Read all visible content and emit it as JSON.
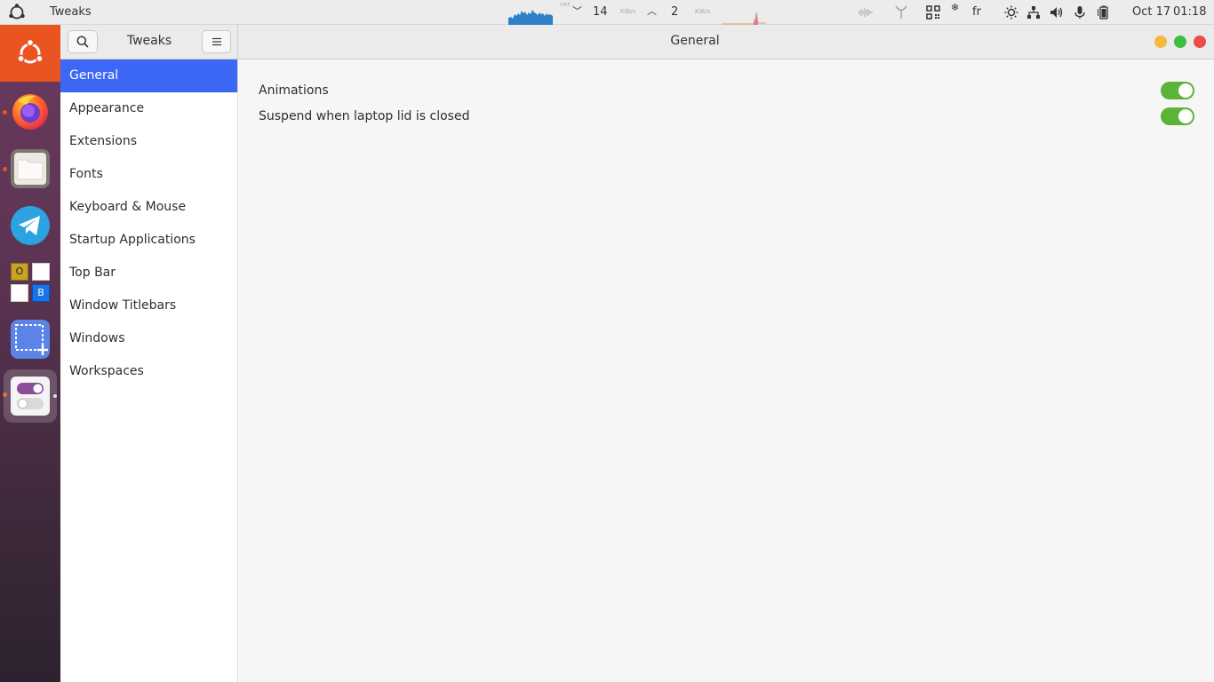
{
  "topbar": {
    "app_name": "Tweaks",
    "net_label": "net",
    "down_value": "14",
    "down_unit": "KiB/s",
    "up_value": "2",
    "up_unit": "KiB/s",
    "keyboard_layout": "fr",
    "date": "Oct 17",
    "time": "01:18"
  },
  "dock": {
    "items": [
      {
        "name": "ubuntu-logo"
      },
      {
        "name": "firefox"
      },
      {
        "name": "files"
      },
      {
        "name": "telegram"
      },
      {
        "name": "office-apps",
        "letters": [
          "O",
          "B"
        ]
      },
      {
        "name": "screenshot"
      },
      {
        "name": "tweaks"
      }
    ]
  },
  "header": {
    "left_title": "Tweaks",
    "title": "General"
  },
  "sidebar": {
    "items": [
      {
        "label": "General",
        "selected": true
      },
      {
        "label": "Appearance"
      },
      {
        "label": "Extensions"
      },
      {
        "label": "Fonts"
      },
      {
        "label": "Keyboard & Mouse"
      },
      {
        "label": "Startup Applications"
      },
      {
        "label": "Top Bar"
      },
      {
        "label": "Window Titlebars"
      },
      {
        "label": "Windows"
      },
      {
        "label": "Workspaces"
      }
    ]
  },
  "main": {
    "settings": [
      {
        "label": "Animations",
        "enabled": true
      },
      {
        "label": "Suspend when laptop lid is closed",
        "enabled": true
      }
    ]
  },
  "colors": {
    "accent": "#3d68f5",
    "switch_on": "#5cb335",
    "ubuntu_orange": "#e95420"
  }
}
